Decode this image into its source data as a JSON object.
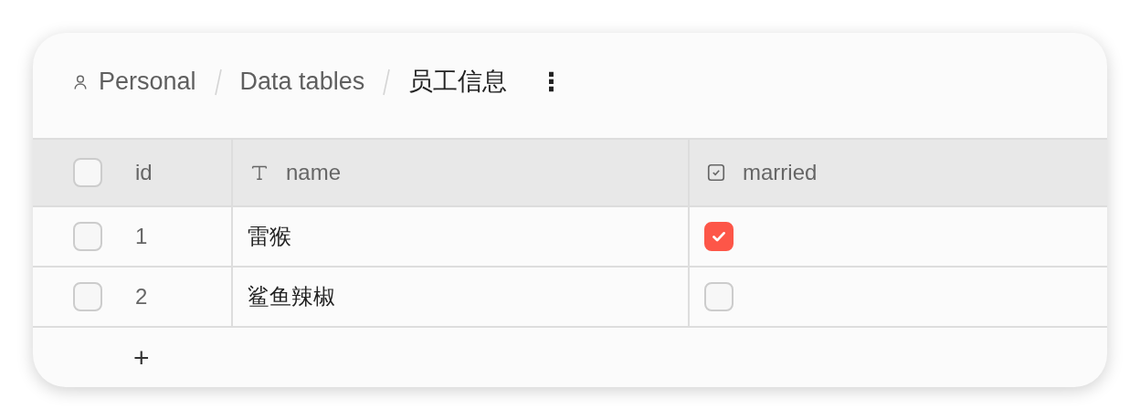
{
  "breadcrumb": [
    {
      "label": "Personal",
      "kind": "user"
    },
    {
      "label": "Data tables",
      "kind": "plain"
    },
    {
      "label": "员工信息",
      "kind": "current"
    }
  ],
  "more_menu": "⋮",
  "table": {
    "select_all": {
      "selected": false
    },
    "columns": [
      {
        "label": "id",
        "kind": "id"
      },
      {
        "label": "name",
        "kind": "text"
      },
      {
        "label": "married",
        "kind": "checkbox"
      }
    ],
    "rows": [
      {
        "selected": false,
        "id": "1",
        "name": "雷猴",
        "married": true
      },
      {
        "selected": false,
        "id": "2",
        "name": "鲨鱼辣椒",
        "married": false
      }
    ],
    "add_row": "+"
  }
}
